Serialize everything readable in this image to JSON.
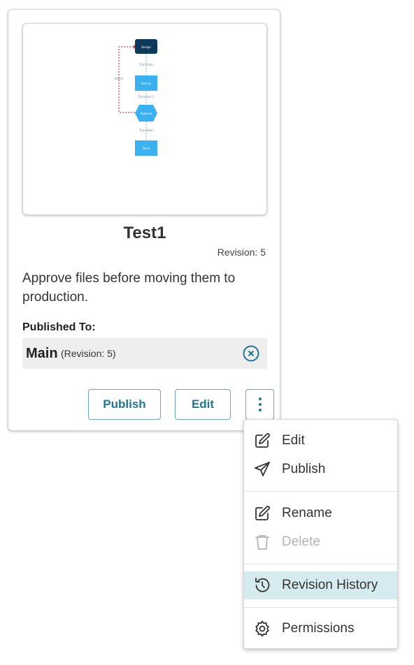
{
  "card": {
    "title": "Test1",
    "revision": "Revision: 5",
    "description": "Approve files before moving them to production.",
    "published_to_label": "Published To:",
    "published": {
      "name": "Main",
      "revision": "(Revision: 5)"
    },
    "buttons": {
      "publish": "Publish",
      "edit": "Edit",
      "more_icon": "vertical-dots-icon"
    }
  },
  "diagram": {
    "nodes": [
      "Design",
      "Review",
      "Approve",
      "Done"
    ],
    "edge_labels": [
      "Transition",
      "Transition 2",
      "Transition",
      "Reject"
    ]
  },
  "menu": {
    "items": [
      {
        "label": "Edit",
        "icon": "pencil-icon",
        "enabled": true
      },
      {
        "label": "Publish",
        "icon": "paper-plane-icon",
        "enabled": true
      },
      {
        "label": "Rename",
        "icon": "pencil-icon",
        "enabled": true
      },
      {
        "label": "Delete",
        "icon": "trash-icon",
        "enabled": false
      },
      {
        "label": "Revision History",
        "icon": "history-icon",
        "enabled": true,
        "highlighted": true
      },
      {
        "label": "Permissions",
        "icon": "gear-icon",
        "enabled": true
      }
    ]
  },
  "colors": {
    "accent": "#1f7794",
    "node_fill": "#3ab2f2",
    "start_node_fill": "#0d3a5c",
    "reject_edge": "#e04040",
    "menu_highlight": "#d6ebf0"
  }
}
